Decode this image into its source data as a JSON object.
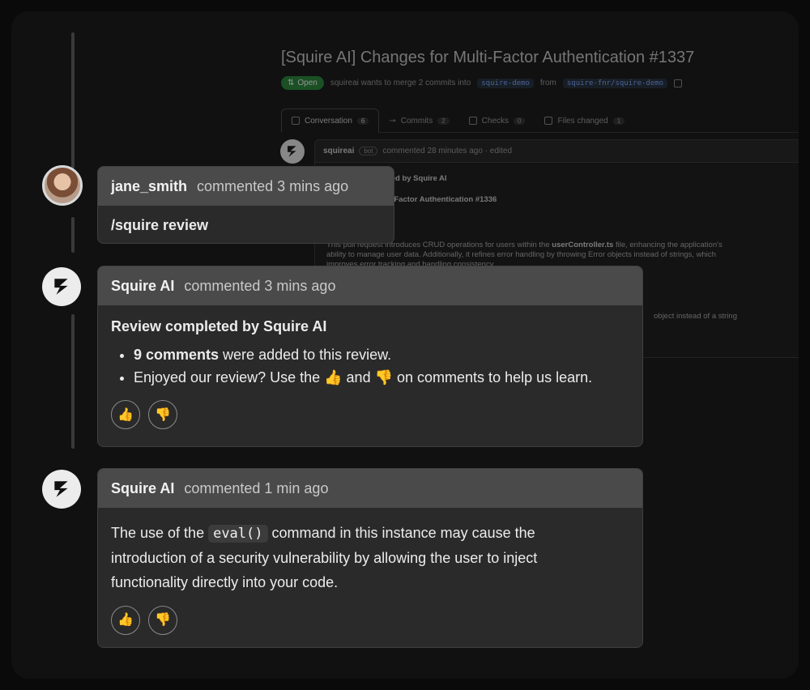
{
  "background_pr": {
    "title": "[Squire AI] Changes for Multi-Factor Authentication #1337",
    "status": "Open",
    "merge_text": "squireai wants to merge 2 commits into",
    "base_branch": "squire-demo",
    "from_text": "from",
    "head_branch": "squire-fnr/squire-demo",
    "tabs": [
      {
        "label": "Conversation",
        "count": "6"
      },
      {
        "label": "Commits",
        "count": "2"
      },
      {
        "label": "Checks",
        "count": "0"
      },
      {
        "label": "Files changed",
        "count": "1"
      }
    ],
    "comment": {
      "author": "squireai",
      "badge": "bot",
      "meta": "commented 28 minutes ago · edited",
      "line1": "Pull request created by Squire AI",
      "line2": "Changes for Multi-Factor Authentication #1336",
      "line3": "This pull request introduces CRUD operations for users within the",
      "line3_file": "userController.ts",
      "line3_end": "file, enhancing the application's",
      "line4": "ability to manage user data. Additionally, it refines error handling by throwing Error objects instead of strings, which",
      "line5": "improves error tracking and handling consistency.",
      "line6": "object instead of a string"
    }
  },
  "comments": [
    {
      "author": "jane_smith",
      "meta": "commented 3 mins ago",
      "body": "/squire review"
    },
    {
      "author": "Squire AI",
      "meta": "commented 3 mins ago",
      "heading": "Review completed by Squire AI",
      "bullet1_bold": "9 comments",
      "bullet1_rest": " were added to this review.",
      "bullet2_a": "Enjoyed our review? Use the ",
      "bullet2_b": " and ",
      "bullet2_c": " on comments to help us learn."
    },
    {
      "author": "Squire AI",
      "meta": "commented 1 min ago",
      "text_a": "The use of the ",
      "code": "eval()",
      "text_b": " command in this instance may cause the",
      "line2": "introduction of a security vulnerability by allowing the user to inject",
      "line3": "functionality directly into your code."
    }
  ],
  "icons": {
    "thumbs_up": "👍",
    "thumbs_down": "👎"
  }
}
